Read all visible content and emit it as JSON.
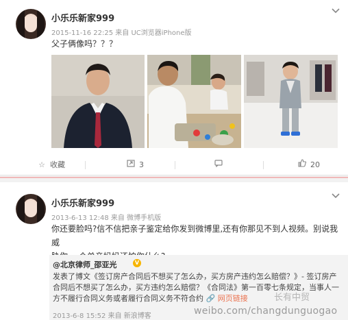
{
  "post1": {
    "author": "小乐乐新家999",
    "meta": "2015-11-16 22:25 来自 UC浏览器iPhone版",
    "text": "父子俩像吗？？？",
    "actions": {
      "favorite_label": "收藏",
      "repost_count": "3",
      "comment_count": "",
      "like_count": "20"
    }
  },
  "post2": {
    "author": "小乐乐新家999",
    "meta": "2013-6-13 12:48 来自 微博手机版",
    "text_line1": "你还要脸吗?信不信把亲子鉴定给你发到微博里,还有你那见不到人视频。别说我威",
    "text_line2": "胁你,一个单亲妈妈还怕你什么?",
    "quote": {
      "author": "@北京律师_邵亚光",
      "badge": "V",
      "text_main": "发表了博文《签订房产合同后不想买了怎么办，买方房产违约怎么赔偿？》- 签订房产合同后不想买了怎么办，买方违约怎么赔偿？《合同法》第一百零七条规定，当事人一方不履行合同义务或者履行合同义务不符合约",
      "link_label": "网页链接",
      "meta": "2013-6-8 15:52 来自 新浪博客"
    }
  },
  "watermark": {
    "url": "weibo.com/changdunguogao",
    "logo_text": "长有中贸"
  },
  "icons": {
    "caret": "chevron-down-icon",
    "favorite": "star-icon",
    "repost": "repost-icon",
    "comment": "comment-icon",
    "like": "thumbs-up-icon"
  }
}
